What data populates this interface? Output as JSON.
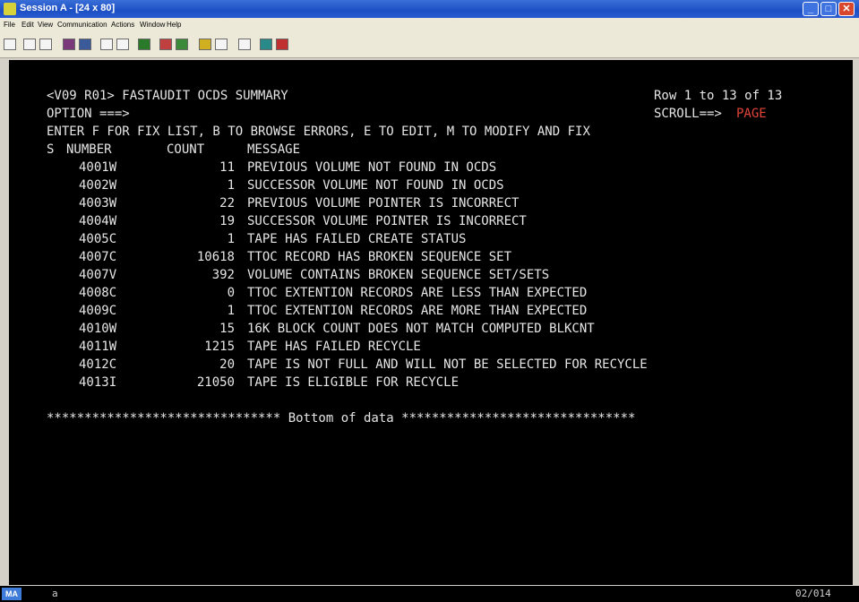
{
  "window": {
    "title": "Session A - [24 x 80]",
    "controls": {
      "minimize": "_",
      "maximize": "□",
      "close": "✕"
    }
  },
  "menu": [
    "File",
    "Edit",
    "View",
    "Communication",
    "Actions",
    "Window",
    "Help"
  ],
  "toolbar_icons": [
    "print-icon",
    "copy-icon",
    "paste-icon",
    "send-icon",
    "receive-icon",
    "display-icon",
    "settings-icon",
    "chart-icon",
    "macro-record-icon",
    "macro-play-icon",
    "color-icon",
    "keyboard-icon",
    "help-icon",
    "connect-icon",
    "disconnect-icon"
  ],
  "screen": {
    "header_left": "<V09 R01> FASTAUDIT OCDS SUMMARY",
    "header_right": "Row 1 to 13 of 13",
    "option_label": "OPTION ===>",
    "scroll_label": "SCROLL==>",
    "scroll_value": "PAGE",
    "instructions": "ENTER F FOR FIX LIST, B TO BROWSE ERRORS, E TO EDIT, M TO MODIFY AND FIX",
    "columns": {
      "s": "S",
      "number": "NUMBER",
      "count": "COUNT",
      "message": "MESSAGE"
    },
    "rows": [
      {
        "number": "4001W",
        "count": "11",
        "message": "PREVIOUS VOLUME NOT FOUND IN OCDS"
      },
      {
        "number": "4002W",
        "count": "1",
        "message": "SUCCESSOR VOLUME NOT FOUND IN OCDS"
      },
      {
        "number": "4003W",
        "count": "22",
        "message": "PREVIOUS VOLUME POINTER IS INCORRECT"
      },
      {
        "number": "4004W",
        "count": "19",
        "message": "SUCCESSOR VOLUME POINTER IS INCORRECT"
      },
      {
        "number": "4005C",
        "count": "1",
        "message": "TAPE HAS FAILED CREATE STATUS"
      },
      {
        "number": "4007C",
        "count": "10618",
        "message": "TTOC RECORD HAS BROKEN SEQUENCE SET"
      },
      {
        "number": "4007V",
        "count": "392",
        "message": "VOLUME CONTAINS BROKEN SEQUENCE SET/SETS"
      },
      {
        "number": "4008C",
        "count": "0",
        "message": "TTOC EXTENTION RECORDS ARE LESS THAN EXPECTED"
      },
      {
        "number": "4009C",
        "count": "1",
        "message": "TTOC EXTENTION RECORDS ARE MORE THAN EXPECTED"
      },
      {
        "number": "4010W",
        "count": "15",
        "message": "16K BLOCK COUNT DOES NOT MATCH COMPUTED BLKCNT"
      },
      {
        "number": "4011W",
        "count": "1215",
        "message": "TAPE HAS FAILED RECYCLE"
      },
      {
        "number": "4012C",
        "count": "20",
        "message": "TAPE IS NOT FULL AND WILL NOT BE SELECTED FOR RECYCLE"
      },
      {
        "number": "4013I",
        "count": "21050",
        "message": "TAPE IS ELIGIBLE FOR RECYCLE"
      }
    ],
    "bottom_marker": "******************************* Bottom of data *******************************"
  },
  "status": {
    "indicator": "MA",
    "session": "a",
    "cursor": "02/014"
  },
  "colors": {
    "terminal_bg": "#000000",
    "terminal_text": "#e6e6e6",
    "highlight": "#e0443a",
    "titlebar": "#1c4fc4"
  }
}
